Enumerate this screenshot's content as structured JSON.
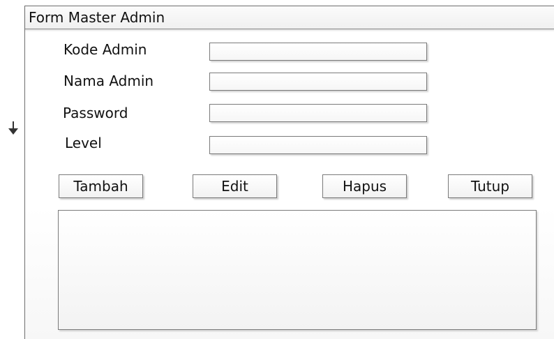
{
  "window": {
    "title": "Form Master Admin"
  },
  "form": {
    "fields": [
      {
        "label": "Kode Admin",
        "value": ""
      },
      {
        "label": "Nama Admin",
        "value": ""
      },
      {
        "label": "Password",
        "value": ""
      },
      {
        "label": "Level",
        "value": ""
      }
    ]
  },
  "buttons": {
    "add": "Tambah",
    "edit": "Edit",
    "delete": "Hapus",
    "close": "Tutup"
  },
  "icons": {
    "side_arrow": "arrow-down-icon"
  }
}
